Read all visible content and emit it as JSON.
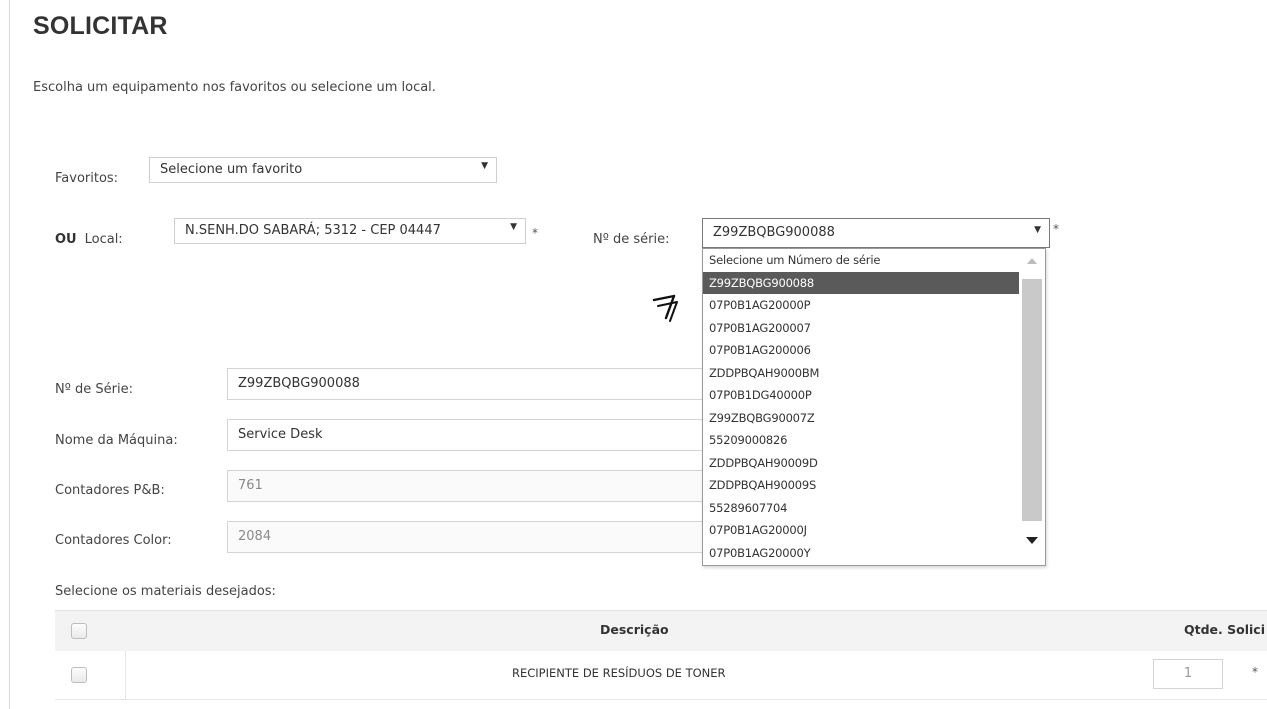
{
  "page": {
    "title": "SOLICITAR",
    "subtitle": "Escolha um equipamento nos favoritos ou selecione um local."
  },
  "favoritos": {
    "label": "Favoritos:",
    "selected": "Selecione um favorito"
  },
  "local": {
    "prefix": "OU",
    "label": "Local:",
    "selected": "N.SENH.DO SABARÁ; 5312 - CEP 04447",
    "required_mark": "*"
  },
  "serie_select": {
    "label": "Nº de série:",
    "selected": "Z99ZBQBG900088",
    "required_mark": "*",
    "options": [
      "Selecione um Número de série",
      "Z99ZBQBG900088",
      "07P0B1AG20000P",
      "07P0B1AG200007",
      "07P0B1AG200006",
      "ZDDPBQAH9000BM",
      "07P0B1DG40000P",
      "Z99ZBQBG90007Z",
      "55209000826",
      "ZDDPBQAH90009D",
      "ZDDPBQAH90009S",
      "55289607704",
      "07P0B1AG20000J",
      "07P0B1AG20000Y"
    ]
  },
  "annotation": {
    "arrow_glyph": "↗"
  },
  "form": {
    "serie": {
      "label": "Nº de Série:",
      "value": "Z99ZBQBG900088"
    },
    "maquina": {
      "label": "Nome da Máquina:",
      "value": "Service Desk"
    },
    "pb": {
      "label": "Contadores P&B:",
      "value": "761"
    },
    "color": {
      "label": "Contadores Color:",
      "value": "2084"
    }
  },
  "materials": {
    "prompt": "Selecione os materiais desejados:",
    "columns": {
      "descricao": "Descrição",
      "qtde": "Qtde. Solici"
    },
    "rows": [
      {
        "descricao": "RECIPIENTE DE RESÍDUOS DE TONER",
        "qtde": "1",
        "required_mark": "*"
      }
    ]
  }
}
